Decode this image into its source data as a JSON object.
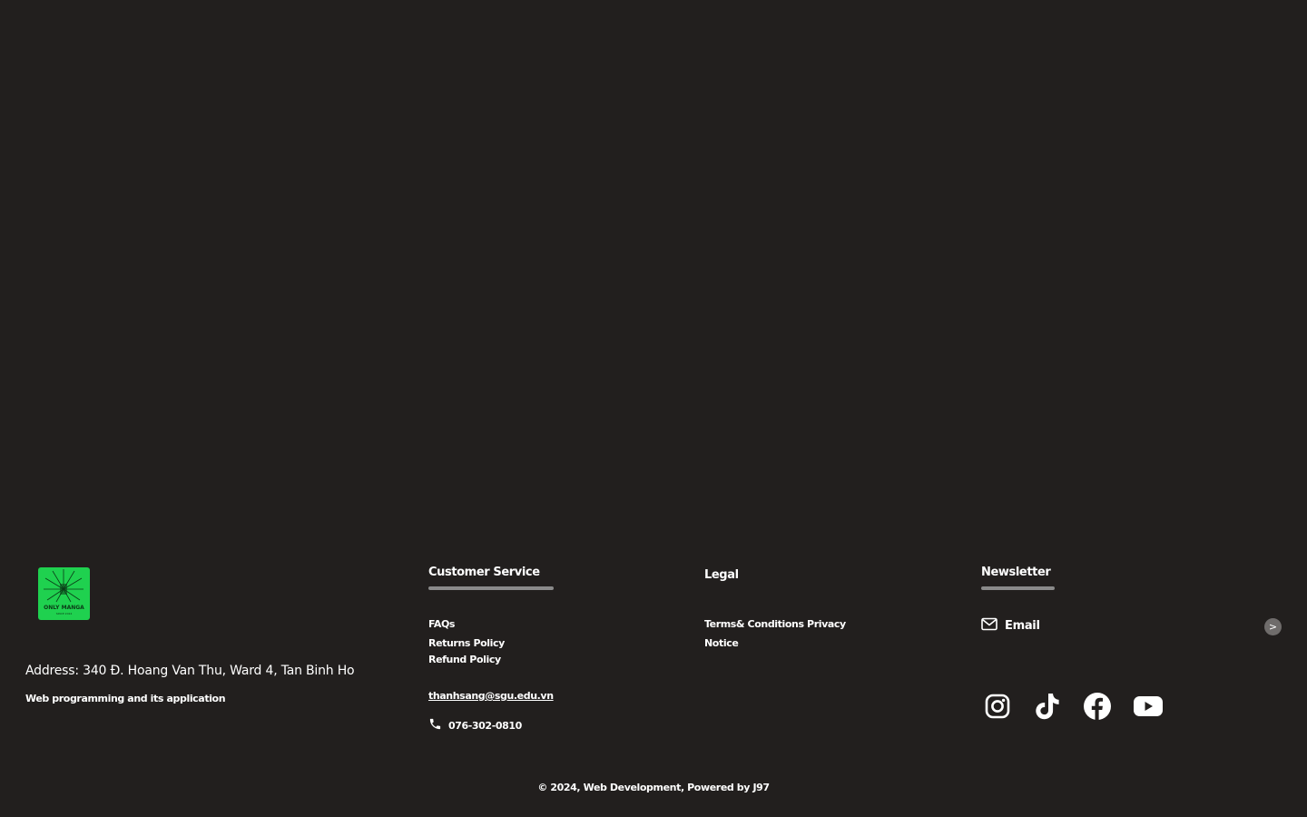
{
  "brand": {
    "logo_text": "ONLY MANGA",
    "logo_subtext": "SINCE 2024",
    "address": "Address: 340 Đ. Hoang Van Thu, Ward 4, Tan Binh Ho",
    "tagline": "Web programming and its application"
  },
  "customer_service": {
    "title": "Customer Service",
    "links": [
      "FAQs",
      "Returns Policy",
      "Refund Policy"
    ],
    "email": "thanhsang@sgu.edu.vn",
    "phone": "076-302-0810"
  },
  "legal": {
    "title": "Legal",
    "line1": "Terms& Conditions Privacy",
    "line2": "Notice"
  },
  "newsletter": {
    "title": "Newsletter",
    "email_label": "Email",
    "submit_label": ">"
  },
  "social": {
    "icons": [
      "instagram-icon",
      "tiktok-icon",
      "facebook-icon",
      "youtube-icon"
    ]
  },
  "footer": {
    "copyright": "© 2024, Web Development, Powered by J97"
  },
  "colors": {
    "background": "#221f1e",
    "logo_green": "#1fd14f",
    "divider": "#8a8a8a",
    "text": "#ffffff"
  }
}
